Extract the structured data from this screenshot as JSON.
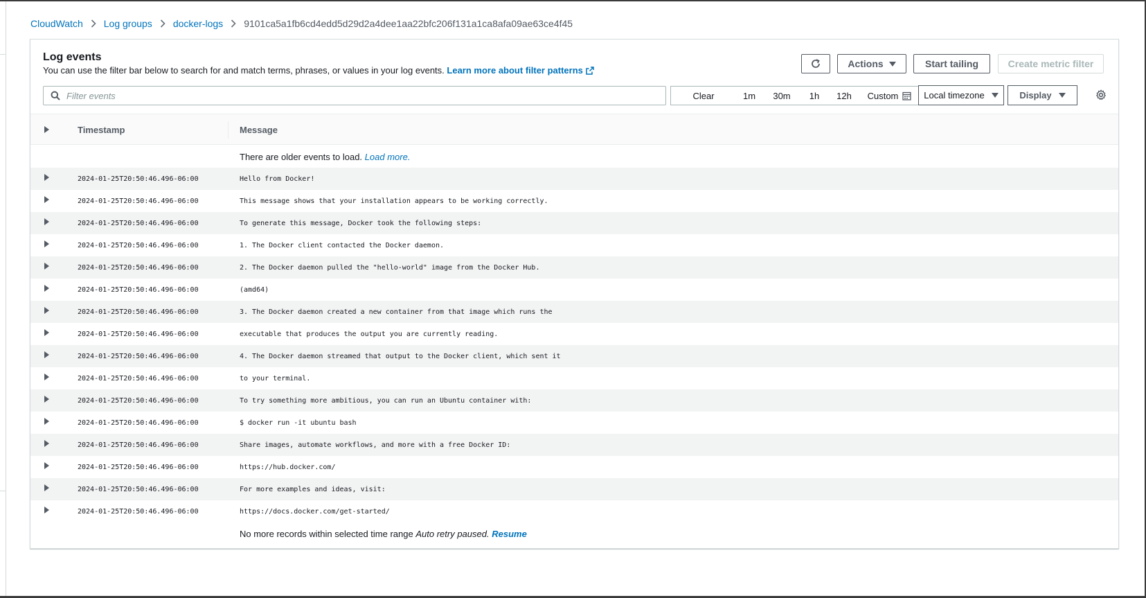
{
  "breadcrumb": {
    "items": [
      "CloudWatch",
      "Log groups",
      "docker-logs"
    ],
    "current": "9101ca5a1fb6cd4edd5d29d2a4dee1aa22bfc206f131a1ca8afa09ae63ce4f45"
  },
  "panel": {
    "title": "Log events",
    "description": "You can use the filter bar below to search for and match terms, phrases, or values in your log events.",
    "learn_more": "Learn more about filter patterns"
  },
  "toolbar": {
    "actions_label": "Actions",
    "start_tailing_label": "Start tailing",
    "create_metric_filter_label": "Create metric filter"
  },
  "filter": {
    "placeholder": "Filter events"
  },
  "time_range": {
    "clear": "Clear",
    "options": [
      "1m",
      "30m",
      "1h",
      "12h"
    ],
    "custom": "Custom",
    "timezone": "Local timezone",
    "display": "Display"
  },
  "table": {
    "columns": {
      "timestamp": "Timestamp",
      "message": "Message"
    },
    "older_notice": "There are older events to load.",
    "load_more": "Load more.",
    "rows": [
      {
        "timestamp": "2024-01-25T20:50:46.496-06:00",
        "message": "Hello from Docker!"
      },
      {
        "timestamp": "2024-01-25T20:50:46.496-06:00",
        "message": "This message shows that your installation appears to be working correctly."
      },
      {
        "timestamp": "2024-01-25T20:50:46.496-06:00",
        "message": "To generate this message, Docker took the following steps:"
      },
      {
        "timestamp": "2024-01-25T20:50:46.496-06:00",
        "message": "1. The Docker client contacted the Docker daemon."
      },
      {
        "timestamp": "2024-01-25T20:50:46.496-06:00",
        "message": "2. The Docker daemon pulled the \"hello-world\" image from the Docker Hub."
      },
      {
        "timestamp": "2024-01-25T20:50:46.496-06:00",
        "message": "(amd64)"
      },
      {
        "timestamp": "2024-01-25T20:50:46.496-06:00",
        "message": "3. The Docker daemon created a new container from that image which runs the"
      },
      {
        "timestamp": "2024-01-25T20:50:46.496-06:00",
        "message": "executable that produces the output you are currently reading."
      },
      {
        "timestamp": "2024-01-25T20:50:46.496-06:00",
        "message": "4. The Docker daemon streamed that output to the Docker client, which sent it"
      },
      {
        "timestamp": "2024-01-25T20:50:46.496-06:00",
        "message": "to your terminal."
      },
      {
        "timestamp": "2024-01-25T20:50:46.496-06:00",
        "message": "To try something more ambitious, you can run an Ubuntu container with:"
      },
      {
        "timestamp": "2024-01-25T20:50:46.496-06:00",
        "message": "$ docker run -it ubuntu bash"
      },
      {
        "timestamp": "2024-01-25T20:50:46.496-06:00",
        "message": "Share images, automate workflows, and more with a free Docker ID:"
      },
      {
        "timestamp": "2024-01-25T20:50:46.496-06:00",
        "message": "https://hub.docker.com/"
      },
      {
        "timestamp": "2024-01-25T20:50:46.496-06:00",
        "message": "For more examples and ideas, visit:"
      },
      {
        "timestamp": "2024-01-25T20:50:46.496-06:00",
        "message": "https://docs.docker.com/get-started/"
      }
    ],
    "end_notice": "No more records within selected time range",
    "auto_retry": "Auto retry paused.",
    "resume": "Resume"
  },
  "icons": {
    "refresh": "refresh-icon",
    "search": "search-icon",
    "calendar": "calendar-icon",
    "settings": "gear-icon",
    "external": "external-link-icon",
    "expand": "caret-right-icon"
  },
  "colors": {
    "link": "#0073bb",
    "text": "#16191f",
    "muted": "#545b64",
    "disabled": "#aab7b8",
    "row_alt": "#f2f3f3"
  }
}
